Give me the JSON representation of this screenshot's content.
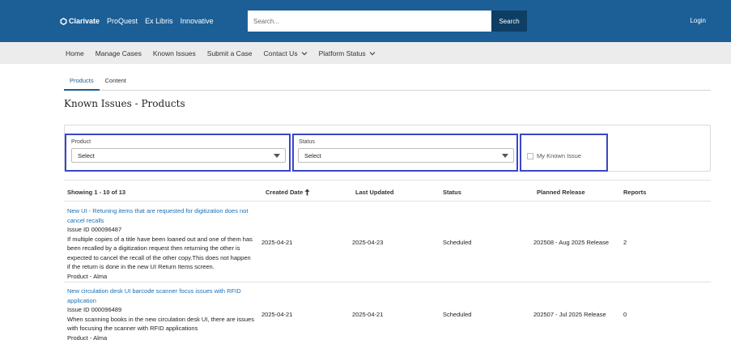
{
  "header": {
    "brand": "Clarivate",
    "sub_brands": [
      "ProQuest",
      "Ex Libris",
      "Innovative"
    ],
    "search_placeholder": "Search...",
    "search_label": "Search",
    "login_label": "Login"
  },
  "nav": {
    "items": [
      "Home",
      "Manage Cases",
      "Known Issues",
      "Submit a Case",
      "Contact Us",
      "Platform Status"
    ]
  },
  "tabs": [
    "Products",
    "Content"
  ],
  "page_title": "Known Issues - Products",
  "filters": {
    "product_label": "Product",
    "product_value": "Select",
    "status_label": "Status",
    "status_value": "Select",
    "my_known_issue_label": "My Known Issue"
  },
  "table": {
    "showing": "Showing 1 - 10 of 13",
    "headers": [
      "Created Date",
      "Last Updated",
      "Status",
      "Planned Release",
      "Reports"
    ],
    "rows": [
      {
        "title": "New UI - Retuning items that are requested for digitization does not cancel recalls",
        "issue_id": "Issue ID 000096487",
        "description": "If multiple copies of a title have been loaned out and one of them has been recalled by a digitization request then returning the other is expected to cancel the recall of the other copy.This does not happen if the return is done in the new UI Return Items screen.",
        "product": "Product - Alma",
        "created": "2025-04-21",
        "updated": "2025-04-23",
        "status": "Scheduled",
        "release": "202508 - Aug 2025 Release",
        "reports": "2"
      },
      {
        "title": "New circulation desk UI barcode scanner focus issues with RFID application",
        "issue_id": "Issue ID 000096489",
        "description": "When scanning books in the new circulation desk UI, there are issues with focusing the scanner with RFID applications",
        "product": "Product - Alma",
        "created": "2025-04-21",
        "updated": "2025-04-21",
        "status": "Scheduled",
        "release": "202507 - Jul 2025 Release",
        "reports": "0"
      }
    ]
  }
}
